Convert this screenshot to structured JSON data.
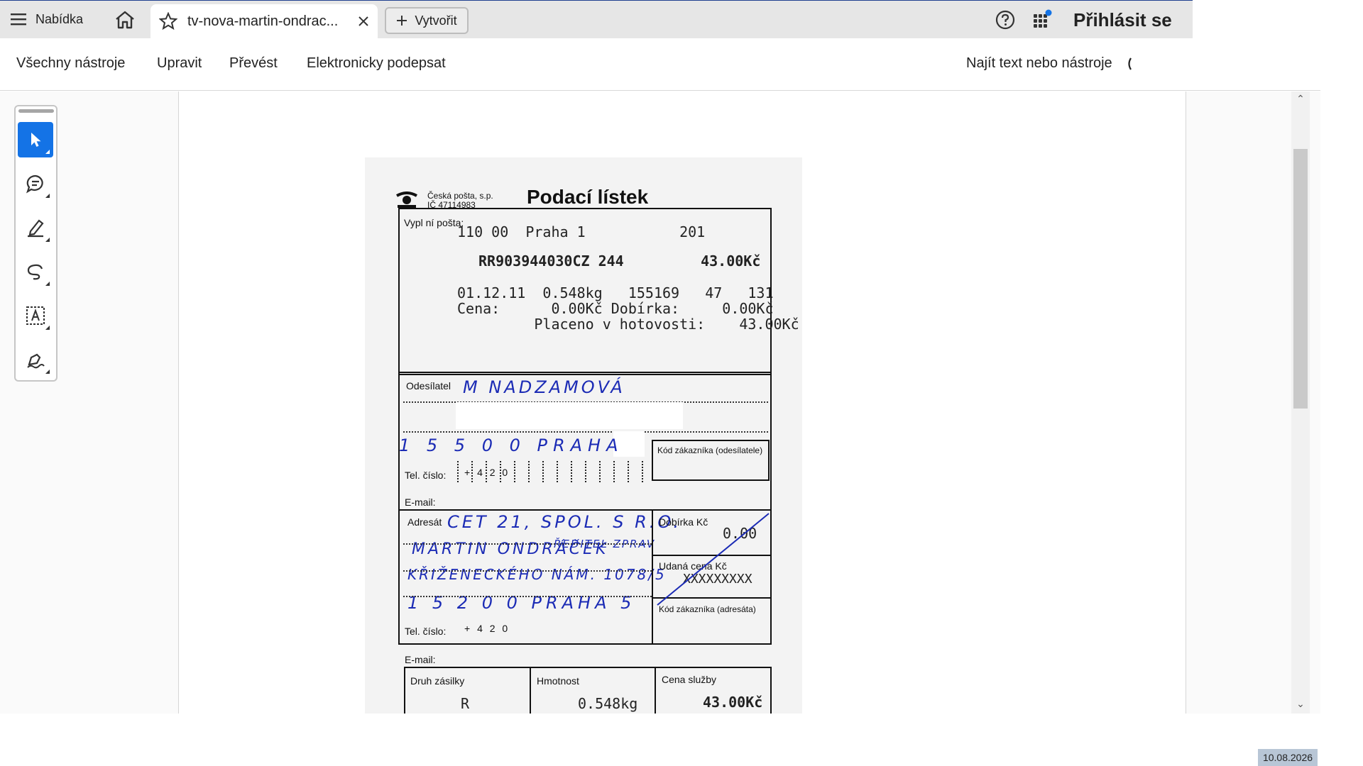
{
  "tabbar": {
    "menu_label": "Nabídka",
    "tab_title": "tv-nova-martin-ondrac...",
    "create_label": "Vytvořit",
    "signin_label": "Přihlásit se"
  },
  "toolbar": {
    "items": [
      "Všechny nástroje",
      "Upravit",
      "Převést",
      "Elektronicky podepsat"
    ],
    "search_label": "Najít text nebo nástroje"
  },
  "tools": [
    "select-icon",
    "comment-icon",
    "highlight-icon",
    "draw-icon",
    "text-select-icon",
    "sign-icon"
  ],
  "document": {
    "company": "Česká pošta, s.p.",
    "company_id": "IČ 47114983",
    "title": "Podací lístek",
    "lbl_office": "Vypl ní pošta:",
    "office_line": "110 00  Praha 1           201",
    "tracking_line": "RR903944030CZ 244         43.00Kč",
    "date_line": "01.12.11  0.548kg   155169   47   131",
    "price_line": "Cena:      0.00Kč Dobírka:     0.00Kč",
    "cash_line": "         Placeno v hotovosti:    43.00Kč",
    "lbl_sender": "Odesílatel",
    "sender_name": "M NADZAMOVÁ",
    "sender_city": "1 5 5  0 0   PRAHA",
    "lbl_customer_code_sender": "Kód zákazníka (odesílatele)",
    "lbl_tel": "Tel. číslo:",
    "tel_prefix": "+ 4 2 0",
    "lbl_email": "E-mail:",
    "lbl_recipient": "Adresát",
    "recipient_line1": "CET 21, SPOL. S R.O.",
    "recipient_line2": "MARTIN ONDRÁČEK",
    "recipient_note": "ŘEDITEL ZPRAV",
    "recipient_line3": "KŘIŽENECKÉHO NÁM. 1078/5",
    "recipient_line4": "1 5 2  0 0   PRAHA 5",
    "lbl_cod": "Dobírka Kč",
    "cod_value": "0.00",
    "lbl_declared": "Udaná cena Kč",
    "declared_value": "XXXXXXXXX",
    "lbl_customer_code_recipient": "Kód zákazníka (adresáta)",
    "lbl_type": "Druh zásilky",
    "type_value": "R",
    "lbl_weight": "Hmotnost",
    "weight_value": "0.548kg",
    "lbl_service_price": "Cena služby",
    "service_price_value": "43.00Kč"
  },
  "status": {
    "date": "10.08.2026"
  }
}
